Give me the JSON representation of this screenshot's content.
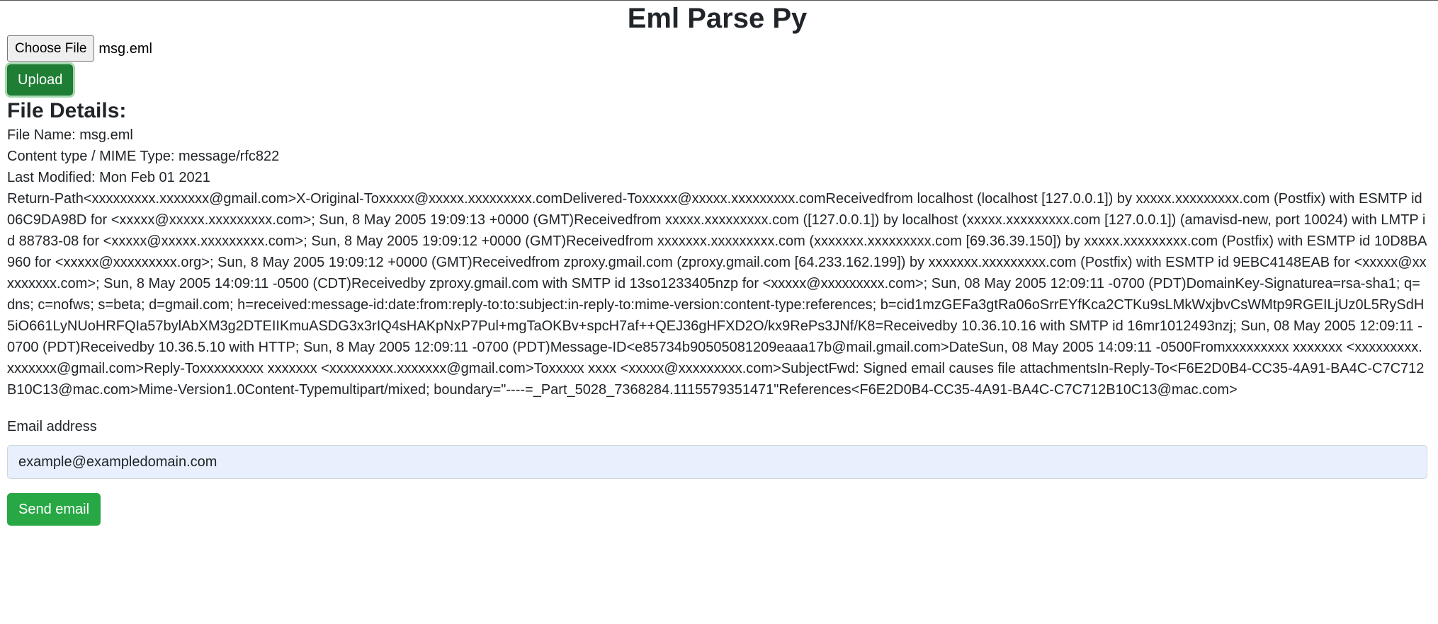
{
  "app": {
    "title": "Eml Parse Py"
  },
  "upload_form": {
    "choose_file_label": "Choose File",
    "chosen_file": "msg.eml",
    "upload_label": "Upload"
  },
  "details": {
    "heading": "File Details:",
    "file_name": "File Name: msg.eml",
    "mime_type": "Content type / MIME Type: message/rfc822",
    "last_modified": "Last Modified: Mon Feb 01 2021",
    "headers_text": "Return-Path<xxxxxxxxx.xxxxxxx@gmail.com>X-Original-Toxxxxx@xxxxx.xxxxxxxxx.comDelivered-Toxxxxx@xxxxx.xxxxxxxxx.comReceivedfrom localhost (localhost [127.0.0.1]) by xxxxx.xxxxxxxxx.com (Postfix) with ESMTP id 06C9DA98D for <xxxxx@xxxxx.xxxxxxxxx.com>; Sun, 8 May 2005 19:09:13 +0000 (GMT)Receivedfrom xxxxx.xxxxxxxxx.com ([127.0.0.1]) by localhost (xxxxx.xxxxxxxxx.com [127.0.0.1]) (amavisd-new, port 10024) with LMTP id 88783-08 for <xxxxx@xxxxx.xxxxxxxxx.com>; Sun, 8 May 2005 19:09:12 +0000 (GMT)Receivedfrom xxxxxxx.xxxxxxxxx.com (xxxxxxx.xxxxxxxxx.com [69.36.39.150]) by xxxxx.xxxxxxxxx.com (Postfix) with ESMTP id 10D8BA960 for <xxxxx@xxxxxxxxx.org>; Sun, 8 May 2005 19:09:12 +0000 (GMT)Receivedfrom zproxy.gmail.com (zproxy.gmail.com [64.233.162.199]) by xxxxxxx.xxxxxxxxx.com (Postfix) with ESMTP id 9EBC4148EAB for <xxxxx@xxxxxxxxx.com>; Sun, 8 May 2005 14:09:11 -0500 (CDT)Receivedby zproxy.gmail.com with SMTP id 13so1233405nzp for <xxxxx@xxxxxxxxx.com>; Sun, 08 May 2005 12:09:11 -0700 (PDT)DomainKey-Signaturea=rsa-sha1; q=dns; c=nofws; s=beta; d=gmail.com; h=received:message-id:date:from:reply-to:to:subject:in-reply-to:mime-version:content-type:references; b=cid1mzGEFa3gtRa06oSrrEYfKca2CTKu9sLMkWxjbvCsWMtp9RGEILjUz0L5RySdH5iO661LyNUoHRFQIa57bylAbXM3g2DTEIIKmuASDG3x3rIQ4sHAKpNxP7Pul+mgTaOKBv+spcH7af++QEJ36gHFXD2O/kx9RePs3JNf/K8=Receivedby 10.36.10.16 with SMTP id 16mr1012493nzj; Sun, 08 May 2005 12:09:11 -0700 (PDT)Receivedby 10.36.5.10 with HTTP; Sun, 8 May 2005 12:09:11 -0700 (PDT)Message-ID<e85734b90505081209eaaa17b@mail.gmail.com>DateSun, 08 May 2005 14:09:11 -0500Fromxxxxxxxxx xxxxxxx <xxxxxxxxx.xxxxxxx@gmail.com>Reply-Toxxxxxxxxx xxxxxxx <xxxxxxxxx.xxxxxxx@gmail.com>Toxxxxx xxxx <xxxxx@xxxxxxxxx.com>SubjectFwd: Signed email causes file attachmentsIn-Reply-To<F6E2D0B4-CC35-4A91-BA4C-C7C712B10C13@mac.com>Mime-Version1.0Content-Typemultipart/mixed; boundary=\"----=_Part_5028_7368284.1115579351471\"References<F6E2D0B4-CC35-4A91-BA4C-C7C712B10C13@mac.com>"
  },
  "email_form": {
    "label": "Email address",
    "value": "example@exampledomain.com",
    "send_label": "Send email"
  },
  "colors": {
    "upload_button": "#1e7e34",
    "send_button": "#28a745",
    "input_background": "#e8f0fe"
  }
}
